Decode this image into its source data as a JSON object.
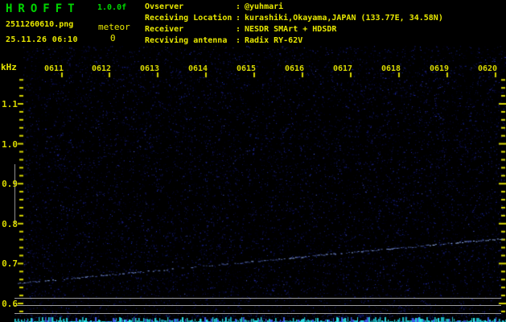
{
  "header": {
    "title": "HROFFT",
    "version": "1.0.0f",
    "filename": "2511260610.png",
    "datetime": "25.11.26 06:10",
    "meteor_label": "meteor",
    "meteor_count": "0"
  },
  "info": {
    "separator": ":",
    "rows": [
      {
        "label": "Ovserver",
        "value": "@yuhmari"
      },
      {
        "label": "Receiving Location",
        "value": "kurashiki,Okayama,JAPAN (133.77E, 34.58N)"
      },
      {
        "label": "Receiver",
        "value": "NESDR SMArt + HDSDR"
      },
      {
        "label": "Recviving antenna",
        "value": "Radix RY-62V"
      }
    ]
  },
  "chart_data": {
    "type": "heatmap",
    "subtype": "radio-meteor-spectrogram",
    "ylabel": "kHz",
    "x_tick_labels": [
      "0611",
      "0612",
      "0613",
      "0614",
      "0615",
      "0616",
      "0617",
      "0618",
      "0619",
      "0620"
    ],
    "y_tick_labels": [
      "1.1",
      "1.0",
      "0.9",
      "0.8",
      "0.7",
      "0.6"
    ],
    "y_tick_values": [
      1.1,
      1.0,
      0.9,
      0.8,
      0.7,
      0.6
    ],
    "ylim": [
      0.575,
      1.16
    ],
    "y_minor_step_khz": 0.02,
    "grid": false,
    "meteor_count": 0,
    "carrier_track": {
      "description": "faint drifting carrier line rising left to right",
      "points": [
        {
          "time": "0610",
          "t_min": 0,
          "khz": 0.65
        },
        {
          "time": "0620",
          "t_min": 10.2,
          "khz": 0.764
        }
      ]
    },
    "reference_lines_khz": [
      0.615,
      0.596,
      0.576
    ],
    "background": "sparse dark-blue noise speckle on black",
    "bottom_signal_strip": "jagged cyan noise-level trace along bottom edge"
  },
  "colors": {
    "title_green": "#00d600",
    "text_yellow": "#e8e800",
    "axis_yellow": "#d6d600",
    "reference_gray": "#9b9b9b",
    "noise_blue": "#0000aa",
    "strip_cyan": "#00cfcf"
  }
}
